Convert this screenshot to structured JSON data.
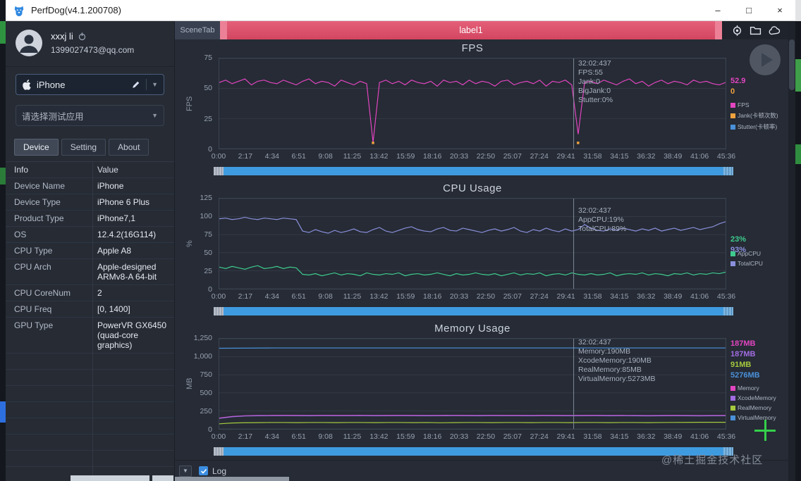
{
  "window": {
    "title": "PerfDog(v4.1.200708)",
    "controls": {
      "minimize": "–",
      "maximize": "□",
      "close": "×"
    }
  },
  "sidebar": {
    "user": {
      "name": "xxxj li",
      "email": "1399027473@qq.com"
    },
    "device_select": {
      "value": "iPhone"
    },
    "app_select": {
      "placeholder": "请选择测试应用"
    },
    "tabs": [
      {
        "label": "Device",
        "active": true
      },
      {
        "label": "Setting",
        "active": false
      },
      {
        "label": "About",
        "active": false
      }
    ],
    "info_table": {
      "headers": [
        "Info",
        "Value"
      ],
      "rows": [
        {
          "label": "Device Name",
          "value": "iPhone"
        },
        {
          "label": "Device Type",
          "value": "iPhone 6 Plus"
        },
        {
          "label": "Product Type",
          "value": "iPhone7,1"
        },
        {
          "label": "OS",
          "value": "12.4.2(16G114)"
        },
        {
          "label": "CPU Type",
          "value": "Apple A8"
        },
        {
          "label": "CPU Arch",
          "value": "Apple-designed ARMv8-A 64-bit"
        },
        {
          "label": "CPU CoreNum",
          "value": "2"
        },
        {
          "label": "CPU Freq",
          "value": "[0, 1400]"
        },
        {
          "label": "GPU Type",
          "value": "PowerVR GX6450 (quad-core graphics)"
        },
        {
          "label": "",
          "value": ""
        },
        {
          "label": "",
          "value": ""
        },
        {
          "label": "",
          "value": ""
        },
        {
          "label": "",
          "value": ""
        },
        {
          "label": "",
          "value": ""
        },
        {
          "label": "",
          "value": ""
        },
        {
          "label": "",
          "value": ""
        },
        {
          "label": "",
          "value": ""
        }
      ]
    }
  },
  "tabbar": {
    "scene_tab": "SceneTab",
    "label_tab": "label1"
  },
  "bottom": {
    "log_label": "Log",
    "log_checked": true
  },
  "watermark": "@稀土掘金技术社区",
  "x_axis": [
    "0:00",
    "2:17",
    "4:34",
    "6:51",
    "9:08",
    "11:25",
    "13:42",
    "15:59",
    "18:16",
    "20:33",
    "22:50",
    "25:07",
    "27:24",
    "29:41",
    "31:58",
    "34:15",
    "36:32",
    "38:49",
    "41:06",
    "45:36"
  ],
  "chart_data": [
    {
      "type": "line",
      "title": "FPS",
      "ylabel": "FPS",
      "ymax": 75,
      "yticks": [
        {
          "v": 0,
          "label": "0"
        },
        {
          "v": 25,
          "label": "25"
        },
        {
          "v": 50,
          "label": "50"
        },
        {
          "v": 75,
          "label": "75"
        }
      ],
      "series": [
        {
          "name": "FPS",
          "color": "#e145c0",
          "values": [
            55,
            57,
            54,
            56,
            58,
            53,
            56,
            57,
            55,
            54,
            57,
            55,
            53,
            56,
            58,
            54,
            56,
            55,
            52,
            57,
            55,
            53,
            56,
            54,
            5,
            55,
            57,
            54,
            56,
            53,
            57,
            55,
            54,
            56,
            52,
            57,
            55,
            56,
            53,
            57,
            54,
            56,
            55,
            52,
            56,
            57,
            53,
            55,
            56,
            54,
            57,
            52,
            56,
            55,
            57,
            53,
            12,
            55,
            56,
            54,
            57,
            55,
            53,
            56,
            58,
            54,
            56,
            52,
            55,
            57,
            54,
            56,
            55,
            53,
            57,
            55,
            56,
            54,
            53,
            55
          ]
        }
      ],
      "marks": [
        {
          "x_frac": 0.304,
          "color": "#f0a23e"
        },
        {
          "x_frac": 0.709,
          "color": "#f0a23e"
        }
      ],
      "crosshair": {
        "time": "32:02:437",
        "x_frac": 0.7,
        "tooltip": [
          "32:02:437",
          "FPS:55",
          "Jank:0",
          "BigJank:0",
          "Stutter:0%"
        ]
      },
      "current_values": [
        {
          "text": "52.9",
          "color": "#e145c0"
        },
        {
          "text": "0",
          "color": "#f0a23e"
        }
      ],
      "legend": [
        {
          "label": "FPS",
          "color": "#e145c0"
        },
        {
          "label": "Jank(卡顿次数)",
          "color": "#f0a23e"
        },
        {
          "label": "Stutter(卡顿率)",
          "color": "#4a90d9"
        }
      ]
    },
    {
      "type": "line",
      "title": "CPU Usage",
      "ylabel": "%",
      "ymax": 125,
      "yticks": [
        {
          "v": 0,
          "label": "0"
        },
        {
          "v": 25,
          "label": "25"
        },
        {
          "v": 50,
          "label": "50"
        },
        {
          "v": 75,
          "label": "75"
        },
        {
          "v": 100,
          "label": "100"
        },
        {
          "v": 125,
          "label": "125"
        }
      ],
      "series": [
        {
          "name": "TotalCPU",
          "color": "#8a90dc",
          "values": [
            97,
            98,
            96,
            97,
            99,
            97,
            96,
            98,
            97,
            96,
            98,
            97,
            96,
            80,
            78,
            82,
            79,
            77,
            81,
            78,
            80,
            83,
            79,
            78,
            82,
            85,
            80,
            78,
            81,
            84,
            86,
            82,
            80,
            79,
            83,
            85,
            81,
            80,
            84,
            82,
            80,
            78,
            81,
            83,
            80,
            82,
            85,
            80,
            78,
            82,
            80,
            84,
            81,
            79,
            83,
            80,
            82,
            89,
            84,
            81,
            80,
            83,
            81,
            84,
            82,
            80,
            83,
            81,
            84,
            80,
            82,
            84,
            81,
            83,
            85,
            82,
            84,
            86,
            90,
            93
          ]
        },
        {
          "name": "AppCPU",
          "color": "#3ecb8e",
          "values": [
            30,
            28,
            31,
            29,
            27,
            30,
            32,
            28,
            29,
            31,
            28,
            30,
            29,
            20,
            19,
            21,
            18,
            20,
            22,
            19,
            21,
            20,
            18,
            22,
            20,
            19,
            21,
            20,
            22,
            18,
            20,
            21,
            19,
            20,
            22,
            20,
            18,
            21,
            19,
            20,
            22,
            20,
            19,
            21,
            18,
            20,
            22,
            19,
            21,
            20,
            22,
            18,
            20,
            21,
            19,
            22,
            20,
            19,
            21,
            19,
            20,
            22,
            18,
            20,
            21,
            20,
            22,
            19,
            21,
            20,
            18,
            21,
            20,
            22,
            19,
            21,
            20,
            22,
            21,
            23
          ]
        }
      ],
      "marks": [],
      "crosshair": {
        "time": "32:02:437",
        "x_frac": 0.7,
        "tooltip": [
          "32:02:437",
          "AppCPU:19%",
          "TotalCPU:89%"
        ]
      },
      "current_values": [
        {
          "text": "23%",
          "color": "#3ecb8e"
        },
        {
          "text": "93%",
          "color": "#8a90dc"
        }
      ],
      "legend": [
        {
          "label": "AppCPU",
          "color": "#3ecb8e"
        },
        {
          "label": "TotalCPU",
          "color": "#8a90dc"
        }
      ]
    },
    {
      "type": "line",
      "title": "Memory Usage",
      "ylabel": "MB",
      "ymax": 1250,
      "yticks": [
        {
          "v": 0,
          "label": "0"
        },
        {
          "v": 250,
          "label": "250"
        },
        {
          "v": 500,
          "label": "500"
        },
        {
          "v": 750,
          "label": "750"
        },
        {
          "v": 1000,
          "label": "1,000"
        },
        {
          "v": 1250,
          "label": "1,250"
        }
      ],
      "series": [
        {
          "name": "VirtualMemory",
          "color": "#4a90d9",
          "values": [
            1118,
            1122,
            1122,
            1122,
            1122,
            1122,
            1122,
            1122,
            1122,
            1122
          ]
        },
        {
          "name": "Memory",
          "color": "#e145c0",
          "values": [
            150,
            172,
            183,
            186,
            187,
            188,
            187,
            186,
            188,
            187,
            187,
            188,
            186,
            187,
            188,
            187,
            186,
            187,
            188,
            187,
            186,
            188,
            187,
            187,
            186,
            188,
            187,
            186,
            187,
            188,
            186,
            187,
            186,
            185,
            186,
            187,
            186,
            185,
            186,
            187
          ]
        },
        {
          "name": "XcodeMemory",
          "color": "#a06ce0",
          "values": [
            146,
            168,
            179,
            182,
            183,
            184,
            183,
            182,
            184,
            183,
            183,
            184,
            182,
            183,
            184,
            183,
            182,
            183,
            184,
            183,
            182,
            184,
            183,
            183,
            182,
            184,
            183,
            182,
            183,
            184,
            182,
            183,
            182,
            181,
            182,
            183,
            182,
            181,
            182,
            183
          ]
        },
        {
          "name": "RealMemory",
          "color": "#a5c93d",
          "values": [
            70,
            82,
            86,
            87,
            88,
            88,
            87,
            88,
            88,
            87,
            88,
            88,
            87,
            88,
            88,
            87,
            88,
            85,
            87,
            88,
            88,
            87,
            88,
            88,
            87,
            88,
            88,
            87,
            88,
            88,
            87,
            88,
            88,
            87,
            88,
            89,
            90,
            91,
            91,
            91
          ]
        }
      ],
      "marks": [],
      "crosshair": {
        "time": "32:02:437",
        "x_frac": 0.7,
        "tooltip": [
          "32:02:437",
          "Memory:190MB",
          "XcodeMemory:190MB",
          "RealMemory:85MB",
          "VirtualMemory:5273MB"
        ]
      },
      "current_values": [
        {
          "text": "187MB",
          "color": "#e145c0"
        },
        {
          "text": "187MB",
          "color": "#a06ce0"
        },
        {
          "text": "91MB",
          "color": "#a5c93d"
        },
        {
          "text": "5276MB",
          "color": "#4a90d9"
        }
      ],
      "legend": [
        {
          "label": "Memory",
          "color": "#e145c0"
        },
        {
          "label": "XcodeMemory",
          "color": "#a06ce0"
        },
        {
          "label": "RealMemory",
          "color": "#a5c93d"
        },
        {
          "label": "VirtualMemory",
          "color": "#4a90d9"
        }
      ]
    }
  ]
}
